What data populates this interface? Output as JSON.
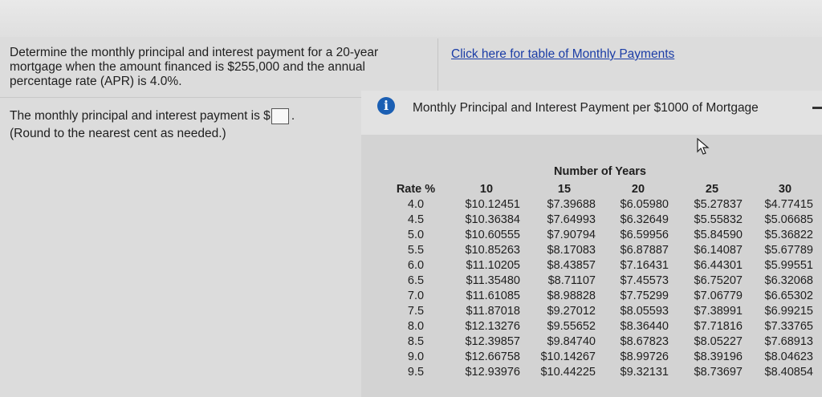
{
  "question": {
    "text": "Determine the monthly principal and interest payment for a 20-year mortgage when the amount financed is $255,000 and the annual percentage rate (APR) is 4.0%."
  },
  "link": {
    "label": "Click here for table of Monthly Payments"
  },
  "answer": {
    "prefix": "The monthly principal and interest payment is $",
    "value": "",
    "suffix": ".",
    "hint": "(Round to the nearest cent as needed.)"
  },
  "popup": {
    "icon": "info-icon",
    "title": "Monthly Principal and Interest Payment per $1000 of Mortgage"
  },
  "table": {
    "group_header": "Number of Years",
    "rate_header": "Rate %",
    "columns": [
      "10",
      "15",
      "20",
      "25",
      "30"
    ],
    "rows": [
      {
        "rate": "4.0",
        "values": [
          "$10.12451",
          "$7.39688",
          "$6.05980",
          "$5.27837",
          "$4.77415"
        ]
      },
      {
        "rate": "4.5",
        "values": [
          "$10.36384",
          "$7.64993",
          "$6.32649",
          "$5.55832",
          "$5.06685"
        ]
      },
      {
        "rate": "5.0",
        "values": [
          "$10.60555",
          "$7.90794",
          "$6.59956",
          "$5.84590",
          "$5.36822"
        ]
      },
      {
        "rate": "5.5",
        "values": [
          "$10.85263",
          "$8.17083",
          "$6.87887",
          "$6.14087",
          "$5.67789"
        ]
      },
      {
        "rate": "6.0",
        "values": [
          "$11.10205",
          "$8.43857",
          "$7.16431",
          "$6.44301",
          "$5.99551"
        ]
      },
      {
        "rate": "6.5",
        "values": [
          "$11.35480",
          "$8.71107",
          "$7.45573",
          "$6.75207",
          "$6.32068"
        ]
      },
      {
        "rate": "7.0",
        "values": [
          "$11.61085",
          "$8.98828",
          "$7.75299",
          "$7.06779",
          "$6.65302"
        ]
      },
      {
        "rate": "7.5",
        "values": [
          "$11.87018",
          "$9.27012",
          "$8.05593",
          "$7.38991",
          "$6.99215"
        ]
      },
      {
        "rate": "8.0",
        "values": [
          "$12.13276",
          "$9.55652",
          "$8.36440",
          "$7.71816",
          "$7.33765"
        ]
      },
      {
        "rate": "8.5",
        "values": [
          "$12.39857",
          "$9.84740",
          "$8.67823",
          "$8.05227",
          "$7.68913"
        ]
      },
      {
        "rate": "9.0",
        "values": [
          "$12.66758",
          "$10.14267",
          "$8.99726",
          "$8.39196",
          "$8.04623"
        ]
      },
      {
        "rate": "9.5",
        "values": [
          "$12.93976",
          "$10.44225",
          "$9.32131",
          "$8.73697",
          "$8.40854"
        ]
      }
    ]
  }
}
